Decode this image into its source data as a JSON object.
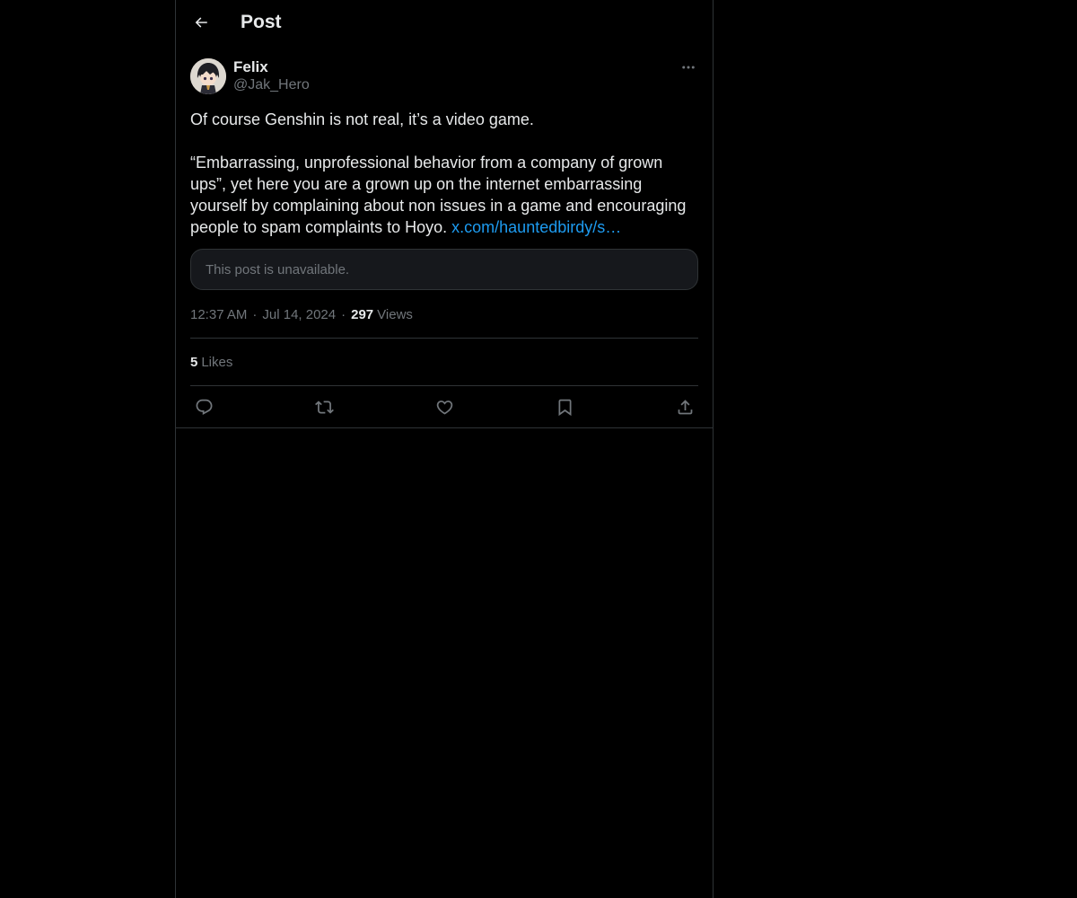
{
  "header": {
    "title": "Post",
    "back_icon": "arrow-left-icon"
  },
  "post": {
    "author": {
      "display_name": "Felix",
      "handle": "@Jak_Hero",
      "avatar_icon": "avatar-image"
    },
    "more_icon": "more-horizontal-icon",
    "text_plain": "Of course Genshin is not real, it’s a video game.\n\n“Embarrassing, unprofessional behavior from a company of grown ups”, yet here you are a grown up on the internet embarrassing yourself by complaining about non issues in a game and encouraging people to spam complaints to Hoyo. ",
    "link_text": "x.com/hauntedbirdy/s…",
    "quote_unavailable": "This post is unavailable.",
    "time": "12:37 AM",
    "separator": "·",
    "date": "Jul 14, 2024",
    "views_count": "297",
    "views_label": "Views",
    "likes_count": "5",
    "likes_label": "Likes"
  },
  "actions": [
    {
      "icon": "reply-icon"
    },
    {
      "icon": "repost-icon"
    },
    {
      "icon": "like-icon"
    },
    {
      "icon": "bookmark-icon"
    },
    {
      "icon": "share-icon"
    }
  ],
  "colors": {
    "background": "#000000",
    "text": "#e7e9ea",
    "secondary_text": "#71767b",
    "link": "#1d9bf0",
    "border": "#2f3336"
  }
}
